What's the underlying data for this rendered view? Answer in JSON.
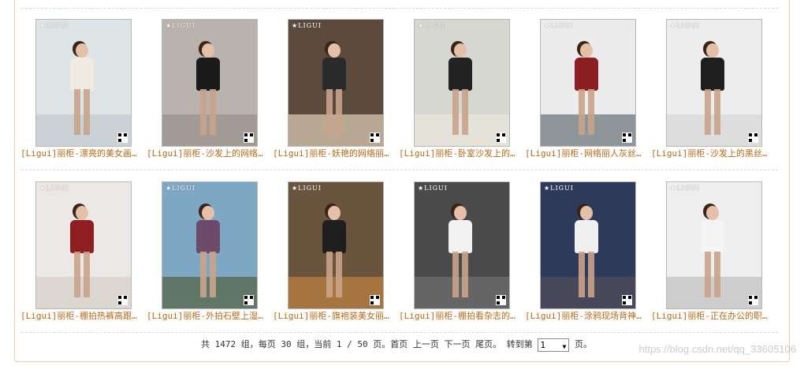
{
  "gallery": {
    "row1": [
      {
        "caption": "[Ligui]丽柜-漂亮的美女画…",
        "logo": "LIGUI",
        "bg": "#dfe4e6",
        "floor": "#c7cfd2",
        "top": "#efeae2"
      },
      {
        "caption": "[Ligui]丽柜-沙发上的网络…",
        "logo": "LIGUI",
        "bg": "#b9b2ad",
        "floor": "#9d9590",
        "top": "#1a1a1a"
      },
      {
        "caption": "[Ligui]丽柜-妖艳的网络丽…",
        "logo": "LIGUI",
        "bg": "#5c4a3c",
        "floor": "#c9b9a2",
        "top": "#2a2a2a"
      },
      {
        "caption": "[Ligui]丽柜-卧室沙发上的…",
        "logo": "LIGUI",
        "bg": "#d7d7d2",
        "floor": "#e8e4dc",
        "top": "#222222"
      },
      {
        "caption": "[Ligui]丽柜-网络丽人灰丝…",
        "logo": "LIGUI",
        "bg": "#ececec",
        "floor": "#7f878c",
        "top": "#8c1e22"
      },
      {
        "caption": "[Ligui]丽柜-沙发上的黑丝…",
        "logo": "LIGUI",
        "bg": "#ededed",
        "floor": "#d9d9d9",
        "top": "#1e1e1e"
      }
    ],
    "row2": [
      {
        "caption": "[Ligui]丽柜-棚拍热裤高跟…",
        "logo": "LIGUI",
        "bg": "#ece8e6",
        "floor": "#d9d2cb",
        "top": "#8e1e22"
      },
      {
        "caption": "[Ligui]丽柜-外拍石壁上湿…",
        "logo": "LIGUI",
        "bg": "#7ea7c4",
        "floor": "#5a6e58",
        "top": "#6e4a6a"
      },
      {
        "caption": "[Ligui]丽柜-旗袍装美女丽…",
        "logo": "LIGUI",
        "bg": "#6a543e",
        "floor": "#b07a3e",
        "top": "#1e1e1e"
      },
      {
        "caption": "[Ligui]丽柜-棚拍看杂志的…",
        "logo": "LIGUI",
        "bg": "#4a4a4a",
        "floor": "#6a6a6a",
        "top": "#f2f2f2"
      },
      {
        "caption": "[Ligui]丽柜-涂鸦现场背神…",
        "logo": "LIGUI",
        "bg": "#2e3a5a",
        "floor": "#4a4a58",
        "top": "#f0f0f0"
      },
      {
        "caption": "[Ligui]丽柜-正在办公的职…",
        "logo": "LIGUI",
        "bg": "#eeeeee",
        "floor": "#c8c8c8",
        "top": "#f4f4f4"
      }
    ]
  },
  "pager": {
    "summary": "共 1472 组，每页 30 组，当前 1 / 50 页。",
    "first": "首页",
    "prev": "上一页",
    "next": "下一页",
    "last": "尾页。",
    "goto_label": "转到第",
    "page_value": "1",
    "goto_suffix": "页。"
  },
  "watermark": "https://blog.csdn.net/qq_33605106",
  "colors": {
    "caption": "#b06a1a",
    "border": "#f0c8b0",
    "divider": "#d8d8d8"
  }
}
